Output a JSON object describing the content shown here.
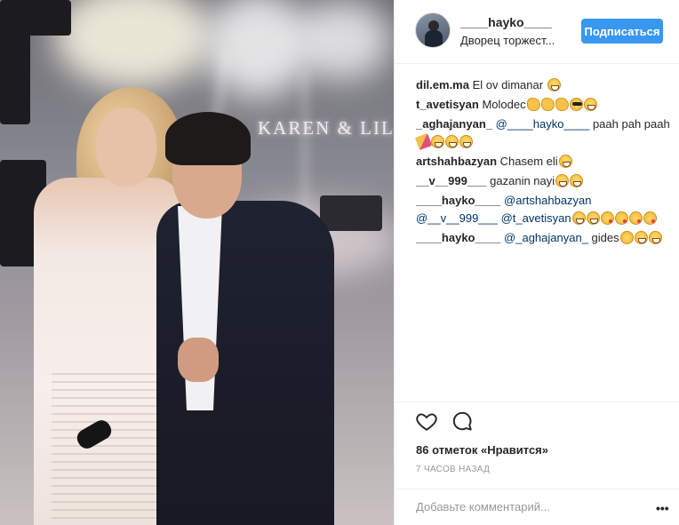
{
  "post": {
    "stage_sign": "KAREN & LIL"
  },
  "header": {
    "username": "____hayko____",
    "location": "Дворец торжест...",
    "follow_label": "Подписаться",
    "accent_color": "#3897f0"
  },
  "comments": [
    {
      "user": "dil.em.ma",
      "parts": [
        {
          "t": "text",
          "v": " El ov dimanar "
        }
      ],
      "emojis": [
        "grin"
      ]
    },
    {
      "user": "t_avetisyan",
      "parts": [
        {
          "t": "text",
          "v": " Molodec"
        }
      ],
      "emojis": [
        "clap",
        "clap",
        "clap",
        "cool",
        "grin"
      ]
    },
    {
      "user": "_aghajanyan_",
      "parts": [
        {
          "t": "mention",
          "v": " @____hayko____"
        },
        {
          "t": "text",
          "v": " paah pah paah"
        }
      ],
      "emojis": [
        "party",
        "grin",
        "grin",
        "grin"
      ]
    },
    {
      "user": "artshahbazyan",
      "parts": [
        {
          "t": "text",
          "v": " Chasem eli"
        }
      ],
      "emojis": [
        "grin"
      ]
    },
    {
      "user": "__v__999___",
      "parts": [
        {
          "t": "text",
          "v": " gazanin nayi"
        }
      ],
      "emojis": [
        "grin",
        "grin"
      ]
    },
    {
      "user": "____hayko____",
      "parts": [
        {
          "t": "mention",
          "v": " @artshahbazyan"
        },
        {
          "t": "mention",
          "v": " @__v__999___"
        },
        {
          "t": "mention",
          "v": " @t_avetisyan"
        }
      ],
      "emojis": [
        "grin",
        "grin",
        "kiss",
        "kiss",
        "kiss",
        "kiss"
      ]
    },
    {
      "user": "____hayko____",
      "parts": [
        {
          "t": "mention",
          "v": " @_aghajanyan_"
        },
        {
          "t": "text",
          "v": " gides"
        }
      ],
      "emojis": [
        "smile",
        "grin",
        "grin"
      ]
    }
  ],
  "actions": {
    "like_icon": "heart-icon",
    "comment_icon": "comment-icon",
    "likes_text": "86 отметок «Нравится»",
    "time_text": "7 ЧАСОВ НАЗАД"
  },
  "add_comment": {
    "placeholder": "Добавьте комментарий...",
    "more_label": "•••"
  }
}
